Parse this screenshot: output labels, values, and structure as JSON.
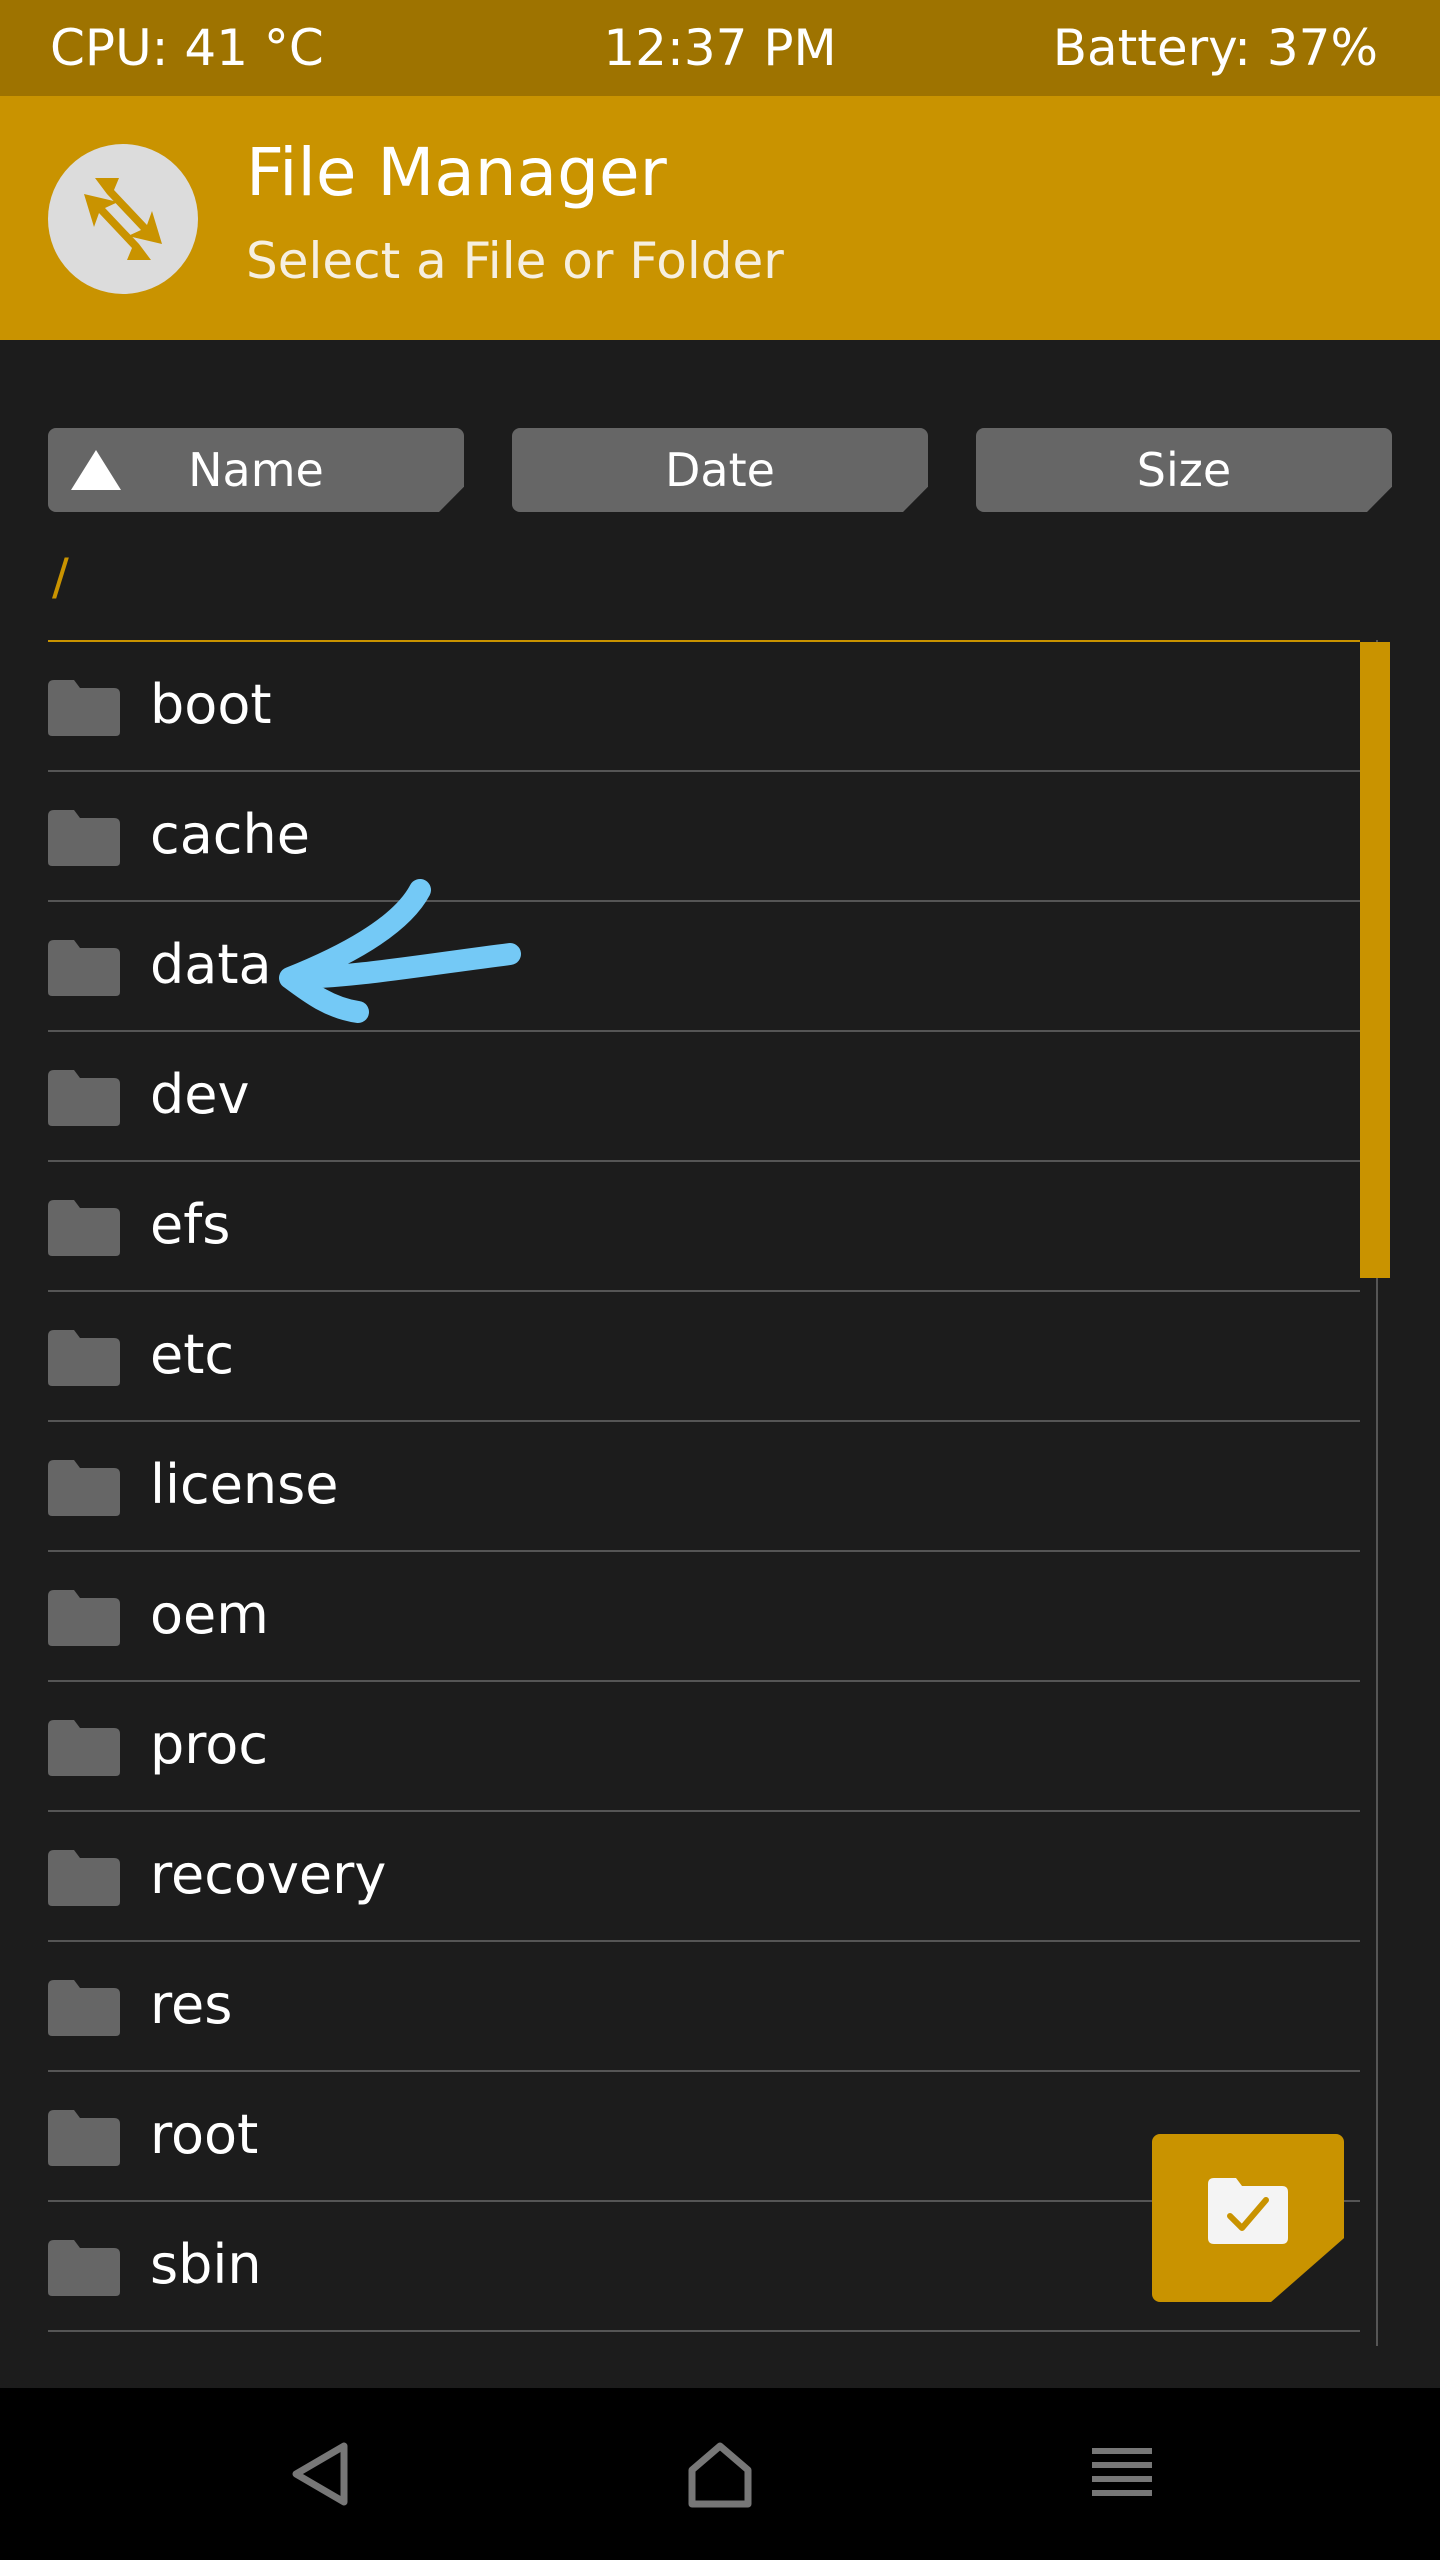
{
  "status_bar": {
    "cpu": "CPU: 41 °C",
    "time": "12:37 PM",
    "battery": "Battery: 37%"
  },
  "header": {
    "title": "File Manager",
    "subtitle": "Select a File or Folder",
    "logo_icon": "twrp-logo-icon"
  },
  "sort_buttons": {
    "name": "Name",
    "date": "Date",
    "size": "Size",
    "name_icon": "triangle-up-icon"
  },
  "current_path": "/",
  "file_list": {
    "items": [
      {
        "label": "boot",
        "icon": "folder-icon"
      },
      {
        "label": "cache",
        "icon": "folder-icon"
      },
      {
        "label": "data",
        "icon": "folder-icon"
      },
      {
        "label": "dev",
        "icon": "folder-icon"
      },
      {
        "label": "efs",
        "icon": "folder-icon"
      },
      {
        "label": "etc",
        "icon": "folder-icon"
      },
      {
        "label": "license",
        "icon": "folder-icon"
      },
      {
        "label": "oem",
        "icon": "folder-icon"
      },
      {
        "label": "proc",
        "icon": "folder-icon"
      },
      {
        "label": "recovery",
        "icon": "folder-icon"
      },
      {
        "label": "res",
        "icon": "folder-icon"
      },
      {
        "label": "root",
        "icon": "folder-icon"
      },
      {
        "label": "sbin",
        "icon": "folder-icon"
      }
    ]
  },
  "select_button": {
    "icon": "folder-check-icon"
  },
  "nav_bar": {
    "back_icon": "back-triangle-icon",
    "home_icon": "home-icon",
    "menu_icon": "menu-lines-icon"
  },
  "colors": {
    "status_bar": "#9e7300",
    "accent": "#c99300",
    "background": "#1c1c1c",
    "button": "#666666",
    "annotation": "#74c9f6"
  }
}
